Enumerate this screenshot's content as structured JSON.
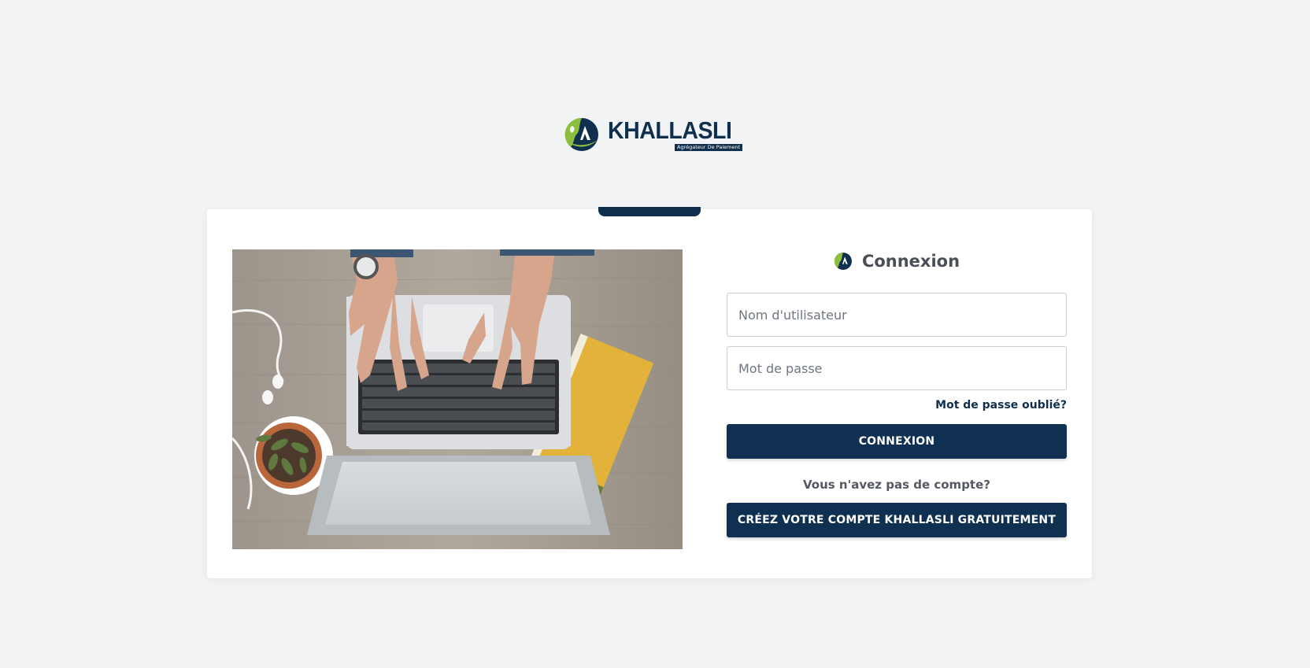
{
  "brand": {
    "name": "KHALLASLI",
    "tagline": "Agrégateur De Paiement",
    "colors": {
      "navy": "#0f2f4f",
      "green": "#8dbf3f"
    }
  },
  "login": {
    "title": "Connexion",
    "username_placeholder": "Nom d'utilisateur",
    "password_placeholder": "Mot de passe",
    "forgot_link": "Mot de passe oublié?",
    "submit_label": "CONNEXION",
    "no_account_text": "Vous n'avez pas de compte?",
    "signup_label": "CRÉEZ VOTRE COMPTE KHALLASLI GRATUITEMENT"
  },
  "hero": {
    "image_icon": "laptop-workspace-photo"
  }
}
